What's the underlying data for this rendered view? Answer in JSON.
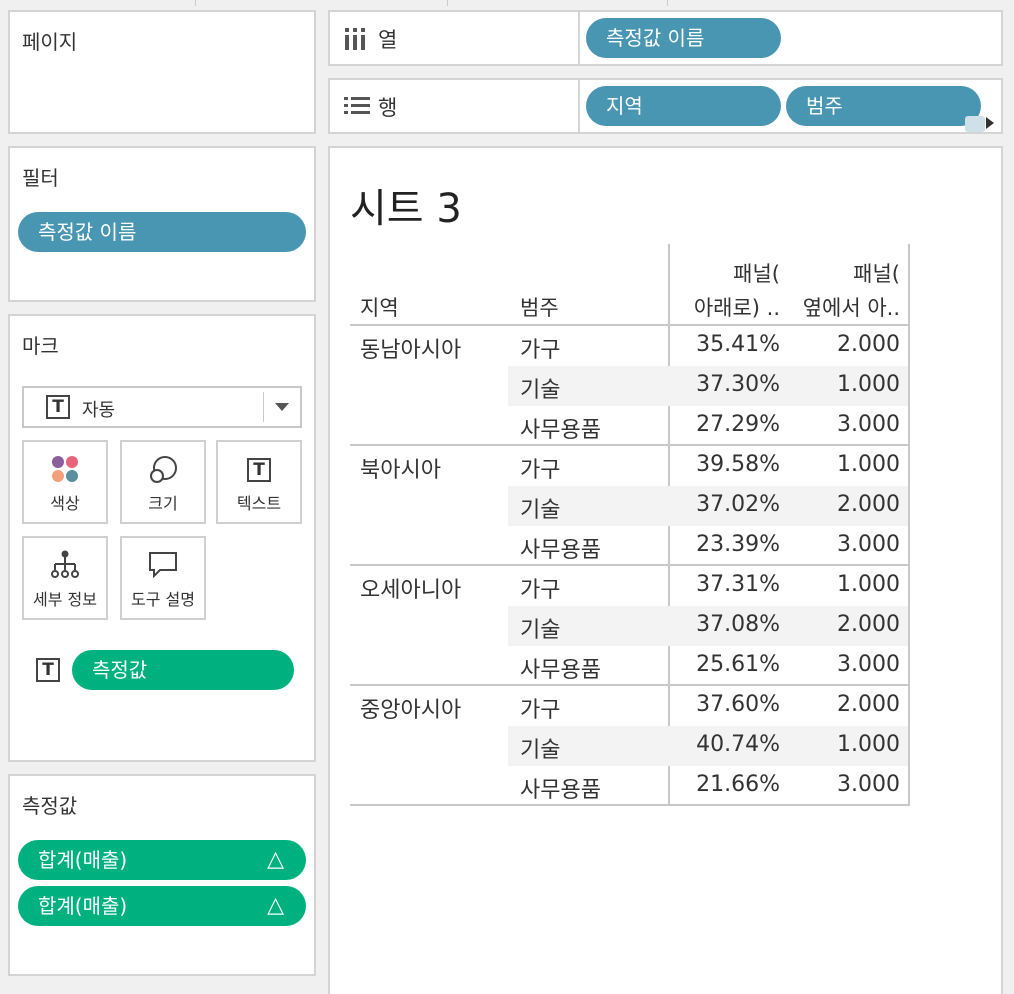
{
  "pages": {
    "title": "페이지"
  },
  "columns_shelf": {
    "label": "열",
    "pills": [
      "측정값 이름"
    ]
  },
  "rows_shelf": {
    "label": "행",
    "pills": [
      "지역",
      "범주"
    ]
  },
  "filters": {
    "title": "필터",
    "pills": [
      "측정값 이름"
    ]
  },
  "marks": {
    "title": "마크",
    "type_label": "자동",
    "cards": [
      {
        "name": "color",
        "label": "색상"
      },
      {
        "name": "size",
        "label": "크기"
      },
      {
        "name": "text",
        "label": "텍스트"
      },
      {
        "name": "detail",
        "label": "세부 정보"
      },
      {
        "name": "tooltip",
        "label": "도구 설명"
      }
    ],
    "text_pill": "측정값"
  },
  "measure_values": {
    "title": "측정값",
    "pills": [
      {
        "label": "합계(매출)",
        "delta": "△"
      },
      {
        "label": "합계(매출)",
        "delta": "△"
      }
    ]
  },
  "view": {
    "sheet_title": "시트 3",
    "headers": {
      "region": "지역",
      "category": "범주",
      "col1_line1": "패널(",
      "col1_line2": "아래로) ..",
      "col2_line1": "패널(",
      "col2_line2": "옆에서 아.."
    },
    "groups": [
      {
        "region": "동남아시아",
        "rows": [
          {
            "category": "가구",
            "pct": "35.41%",
            "rank": "2.000"
          },
          {
            "category": "기술",
            "pct": "37.30%",
            "rank": "1.000"
          },
          {
            "category": "사무용품",
            "pct": "27.29%",
            "rank": "3.000"
          }
        ]
      },
      {
        "region": "북아시아",
        "rows": [
          {
            "category": "가구",
            "pct": "39.58%",
            "rank": "1.000"
          },
          {
            "category": "기술",
            "pct": "37.02%",
            "rank": "2.000"
          },
          {
            "category": "사무용품",
            "pct": "23.39%",
            "rank": "3.000"
          }
        ]
      },
      {
        "region": "오세아니아",
        "rows": [
          {
            "category": "가구",
            "pct": "37.31%",
            "rank": "1.000"
          },
          {
            "category": "기술",
            "pct": "37.08%",
            "rank": "2.000"
          },
          {
            "category": "사무용품",
            "pct": "25.61%",
            "rank": "3.000"
          }
        ]
      },
      {
        "region": "중앙아시아",
        "rows": [
          {
            "category": "가구",
            "pct": "37.60%",
            "rank": "2.000"
          },
          {
            "category": "기술",
            "pct": "40.74%",
            "rank": "1.000"
          },
          {
            "category": "사무용품",
            "pct": "21.66%",
            "rank": "3.000"
          }
        ]
      }
    ]
  },
  "colors": {
    "dimension_pill": "#4996b2",
    "measure_pill": "#00b180"
  }
}
